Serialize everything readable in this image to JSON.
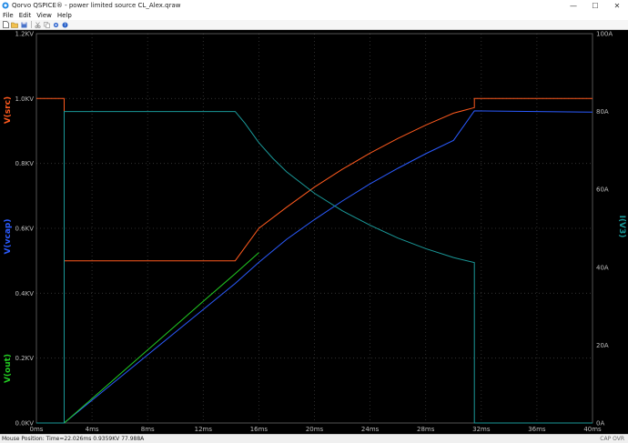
{
  "window": {
    "title": "Qorvo QSPICE® - power limited source CL_Alex.qraw",
    "controls": {
      "minimize": "—",
      "maximize": "☐",
      "close": "✕"
    }
  },
  "menu": {
    "items": [
      "File",
      "Edit",
      "View",
      "Help"
    ]
  },
  "toolbar": {
    "icons": [
      "new-file-icon",
      "open-folder-icon",
      "save-icon",
      "cut-icon",
      "copy-icon",
      "settings-icon",
      "help-icon"
    ]
  },
  "status": {
    "mouse": "Mouse Position: Time=22.026ms  0.9359KV 77.988A",
    "right": "CAP OVR"
  },
  "chart_data": {
    "type": "line",
    "x_unit": "ms",
    "xlim": [
      0,
      40
    ],
    "ylim_left": [
      0,
      1.2
    ],
    "ylim_right": [
      0,
      100
    ],
    "x_ticks": [
      "0ms",
      "4ms",
      "8ms",
      "12ms",
      "16ms",
      "20ms",
      "24ms",
      "28ms",
      "32ms",
      "36ms",
      "40ms"
    ],
    "y_left_ticks": [
      "0.0KV",
      "0.2KV",
      "0.4KV",
      "0.6KV",
      "0.8KV",
      "1.0KV",
      "1.2KV"
    ],
    "y_right_ticks": [
      "0A",
      "20A",
      "40A",
      "60A",
      "80A",
      "100A"
    ],
    "grid": true,
    "left_axis_labels": [
      {
        "text": "V(src)",
        "color": "#ff5a1e",
        "series": "V(src)"
      },
      {
        "text": "V(vcap)",
        "color": "#2b5bff",
        "series": "V(vcap)"
      },
      {
        "text": "V(out)",
        "color": "#22cc22",
        "series": "V(out)"
      }
    ],
    "right_axis_labels": [
      {
        "text": "I(V3)",
        "color": "#1a9999",
        "series": "I(V3)"
      }
    ],
    "colors": {
      "V(src)": "#ff5a1e",
      "V(vcap)": "#2b5bff",
      "V(out)": "#22cc22",
      "I(V3)": "#1a9999"
    },
    "series": [
      {
        "name": "V(src)",
        "axis": "left",
        "unit": "KV",
        "x": [
          0,
          2,
          2,
          14.3,
          16,
          18,
          20,
          22,
          24,
          26,
          28,
          30,
          31.5,
          31.5,
          40
        ],
        "y": [
          1.0,
          1.0,
          0.5,
          0.5,
          0.6,
          0.665,
          0.727,
          0.782,
          0.832,
          0.877,
          0.918,
          0.955,
          0.972,
          1.0,
          1.0
        ]
      },
      {
        "name": "V(vcap)",
        "axis": "left",
        "unit": "KV",
        "x": [
          2,
          4,
          6,
          8,
          10,
          12,
          14.3,
          16,
          18,
          20,
          22,
          24,
          26,
          28,
          30,
          31.5,
          36,
          40
        ],
        "y": [
          0.0,
          0.07,
          0.14,
          0.21,
          0.28,
          0.35,
          0.43,
          0.495,
          0.566,
          0.627,
          0.684,
          0.737,
          0.785,
          0.83,
          0.871,
          0.962,
          0.96,
          0.958
        ]
      },
      {
        "name": "V(out)",
        "axis": "left",
        "unit": "KV",
        "x": [
          2,
          4,
          6,
          8,
          10,
          12,
          14.3,
          16
        ],
        "y": [
          0.0,
          0.075,
          0.15,
          0.225,
          0.3,
          0.375,
          0.46,
          0.525
        ]
      },
      {
        "name": "I(V3)",
        "axis": "right",
        "unit": "A",
        "x": [
          0,
          2,
          2,
          14.3,
          15,
          16,
          17,
          18,
          20,
          22,
          24,
          26,
          28,
          30,
          31.5,
          31.5,
          40
        ],
        "y": [
          0,
          0,
          80,
          80,
          77,
          72,
          68,
          64.5,
          59,
          54.5,
          50.8,
          47.5,
          44.8,
          42.5,
          41.2,
          0,
          0
        ]
      }
    ]
  }
}
